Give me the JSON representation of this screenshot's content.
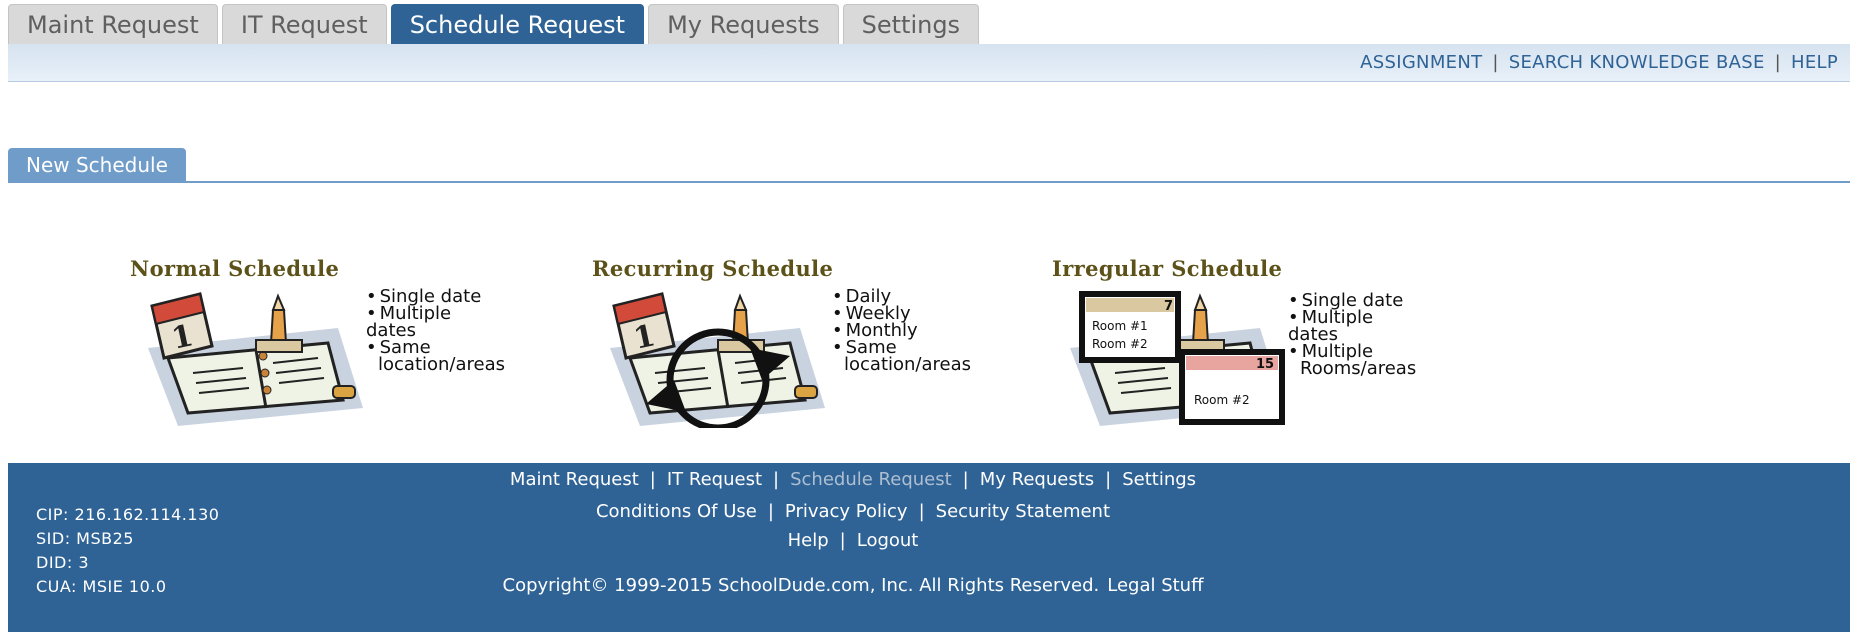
{
  "tabs": [
    {
      "label": "Maint Request",
      "active": false
    },
    {
      "label": "IT Request",
      "active": false
    },
    {
      "label": "Schedule Request",
      "active": true
    },
    {
      "label": "My Requests",
      "active": false
    },
    {
      "label": "Settings",
      "active": false
    }
  ],
  "top_links": {
    "assignment": "ASSIGNMENT",
    "search_kb": "SEARCH KNOWLEDGE BASE",
    "help": "HELP",
    "sep": "|"
  },
  "section_tab": "New Schedule",
  "options": {
    "normal": {
      "title": "Normal Schedule",
      "bullets": [
        "Single date",
        "Multiple dates",
        "Same"
      ],
      "continuation": "location/areas"
    },
    "recurring": {
      "title": "Recurring Schedule",
      "bullets": [
        "Daily",
        "Weekly",
        "Monthly",
        "Same"
      ],
      "continuation": "location/areas"
    },
    "irregular": {
      "title": "Irregular Schedule",
      "bullets": [
        "Single date",
        "Multiple dates",
        "Multiple"
      ],
      "continuation": "Rooms/areas",
      "art_labels": {
        "room1": "Room #1",
        "room2": "Room #2",
        "room2b": "Room #2",
        "day1": "7",
        "day2": "15"
      }
    },
    "calendar_day": "1"
  },
  "footer": {
    "info": [
      "CIP: 216.162.114.130",
      "SID: MSB25",
      "DID: 3",
      "CUA: MSIE 10.0"
    ],
    "nav": [
      "Maint Request",
      "IT Request",
      "Schedule Request",
      "My Requests",
      "Settings"
    ],
    "legal": [
      "Conditions Of Use",
      "Privacy Policy",
      "Security Statement"
    ],
    "account": [
      "Help",
      "Logout"
    ],
    "copyright": "Copyright© 1999-2015 SchoolDude.com, Inc. All Rights Reserved.",
    "legal_stuff": "Legal Stuff",
    "sep": "|"
  },
  "colors": {
    "brand_blue": "#2f6396",
    "section_blue": "#6f9cc9",
    "title_olive": "#5c5119"
  }
}
